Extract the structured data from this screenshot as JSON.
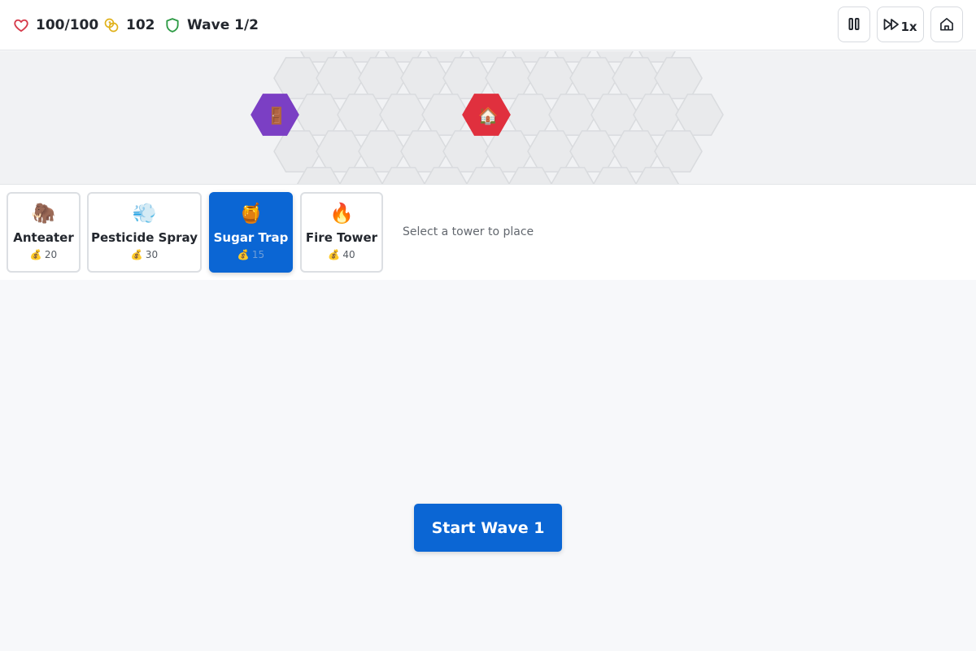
{
  "status": {
    "health": "100/100",
    "gold": "102",
    "wave": "Wave 1/2"
  },
  "controls": {
    "pause_icon": "pause-icon",
    "speed_label": "1x",
    "speed_icon": "fast-forward-icon",
    "home_icon": "home-icon"
  },
  "board": {
    "spawn_icon": "🚪",
    "base_icon": "🏠",
    "spawn_color": "#7b3fc4",
    "base_color": "#e0303e",
    "tile_color": "#e9eaec"
  },
  "towers": [
    {
      "icon": "🦣",
      "name": "Anteater",
      "cost": "20",
      "selected": false
    },
    {
      "icon": "💨",
      "name": "Pesticide Spray",
      "cost": "30",
      "selected": false
    },
    {
      "icon": "🍯",
      "name": "Sugar Trap",
      "cost": "15",
      "selected": true
    },
    {
      "icon": "🔥",
      "name": "Fire Tower",
      "cost": "40",
      "selected": false
    }
  ],
  "cost_icon": "💰",
  "shop_hint": "Select a tower to place",
  "start_button": "Start Wave 1",
  "colors": {
    "accent": "#0b66d4",
    "health": "#d63a4a",
    "gold": "#e0b11a",
    "wave": "#2c9a44"
  }
}
